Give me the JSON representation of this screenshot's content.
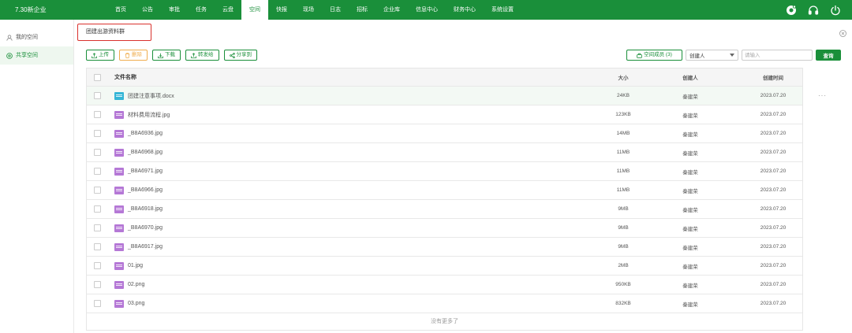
{
  "app": {
    "brand": "7.30新企业"
  },
  "nav": {
    "items": [
      {
        "label": "首页"
      },
      {
        "label": "公告"
      },
      {
        "label": "审批"
      },
      {
        "label": "任务"
      },
      {
        "label": "云盘"
      },
      {
        "label": "空间"
      },
      {
        "label": "快报"
      },
      {
        "label": "现场"
      },
      {
        "label": "日志"
      },
      {
        "label": "招标"
      },
      {
        "label": "企业库"
      },
      {
        "label": "信息中心"
      },
      {
        "label": "财务中心"
      },
      {
        "label": "系统设置"
      }
    ],
    "active": "空间"
  },
  "top_icons": [
    "camera-icon",
    "headset-icon",
    "power-icon"
  ],
  "sidebar": {
    "items": [
      {
        "label": "我的空间",
        "icon": "user-icon"
      },
      {
        "label": "共享空间",
        "icon": "share-icon"
      }
    ],
    "active": "共享空间"
  },
  "space": {
    "title": "团建出游资料群"
  },
  "toolbar": {
    "upload": "上传",
    "delete": "删除",
    "download": "下载",
    "forward": "转发给",
    "share": "分享到"
  },
  "filter": {
    "members": "空间成员 (3)",
    "select_value": "创建人",
    "input_placeholder": "请输入",
    "search": "查询"
  },
  "table": {
    "headers": {
      "name": "文件名称",
      "size": "大小",
      "creator": "创建人",
      "time": "创建时间"
    },
    "rows": [
      {
        "name": "团建注意事项.docx",
        "type": "doc",
        "size": "24KB",
        "creator": "秦建荣",
        "time": "2023.07.20",
        "more": "···"
      },
      {
        "name": "材料费用流程.jpg",
        "type": "img",
        "size": "123KB",
        "creator": "秦建荣",
        "time": "2023.07.20"
      },
      {
        "name": "_B8A6936.jpg",
        "type": "img",
        "size": "14MB",
        "creator": "秦建荣",
        "time": "2023.07.20"
      },
      {
        "name": "_B8A6968.jpg",
        "type": "img",
        "size": "11MB",
        "creator": "秦建荣",
        "time": "2023.07.20"
      },
      {
        "name": "_B8A6971.jpg",
        "type": "img",
        "size": "11MB",
        "creator": "秦建荣",
        "time": "2023.07.20"
      },
      {
        "name": "_B8A6966.jpg",
        "type": "img",
        "size": "11MB",
        "creator": "秦建荣",
        "time": "2023.07.20"
      },
      {
        "name": "_B8A6918.jpg",
        "type": "img",
        "size": "9MB",
        "creator": "秦建荣",
        "time": "2023.07.20"
      },
      {
        "name": "_B8A6970.jpg",
        "type": "img",
        "size": "9MB",
        "creator": "秦建荣",
        "time": "2023.07.20"
      },
      {
        "name": "_B8A6917.jpg",
        "type": "img",
        "size": "9MB",
        "creator": "秦建荣",
        "time": "2023.07.20"
      },
      {
        "name": "01.jpg",
        "type": "img",
        "size": "2MB",
        "creator": "秦建荣",
        "time": "2023.07.20"
      },
      {
        "name": "02.png",
        "type": "img",
        "size": "950KB",
        "creator": "秦建荣",
        "time": "2023.07.20"
      },
      {
        "name": "03.png",
        "type": "img",
        "size": "832KB",
        "creator": "秦建荣",
        "time": "2023.07.20"
      }
    ],
    "footer": "没有更多了"
  },
  "colors": {
    "primary": "#1a8f3a",
    "warning": "#f0ad4e",
    "highlight_border": "#d9312d",
    "doc_icon": "#35b6d6",
    "img_icon": "#b578d6"
  }
}
